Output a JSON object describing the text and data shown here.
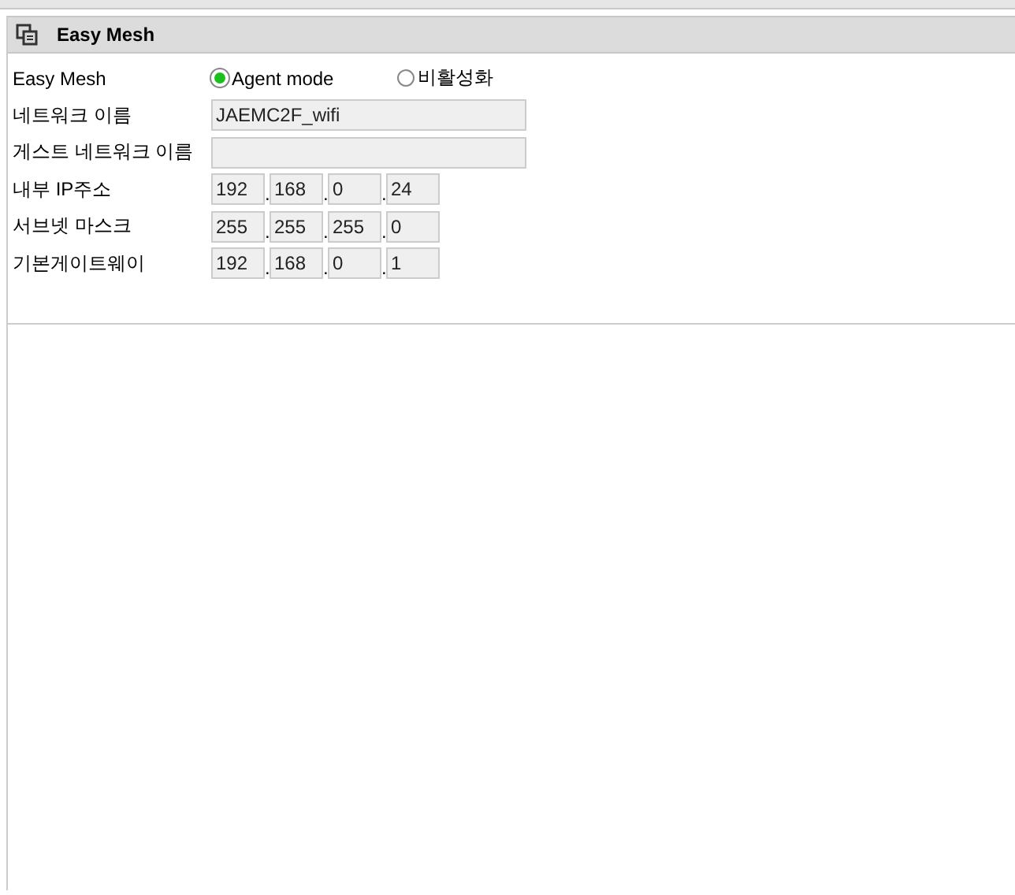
{
  "panel": {
    "title": "Easy Mesh"
  },
  "mode": {
    "label": "Easy Mesh",
    "options": [
      {
        "label": "Agent mode",
        "selected": true
      },
      {
        "label": "비활성화",
        "selected": false
      }
    ]
  },
  "fields": [
    {
      "kind": "text",
      "label": "네트워크 이름",
      "value": "JAEMC2F_wifi"
    },
    {
      "kind": "text",
      "label": "게스트 네트워크 이름"
    },
    {
      "kind": "ip",
      "label": "내부 IP주소",
      "separator": ".",
      "octets": [
        "192",
        "168",
        "0",
        "24"
      ]
    },
    {
      "kind": "ip",
      "label": "서브넷 마스크",
      "separator": ".",
      "octets": [
        "255",
        "255",
        "255",
        "0"
      ]
    },
    {
      "kind": "ip",
      "label": "기본게이트웨이",
      "separator": ".",
      "octets": [
        "192",
        "168",
        "0",
        "1"
      ]
    }
  ]
}
